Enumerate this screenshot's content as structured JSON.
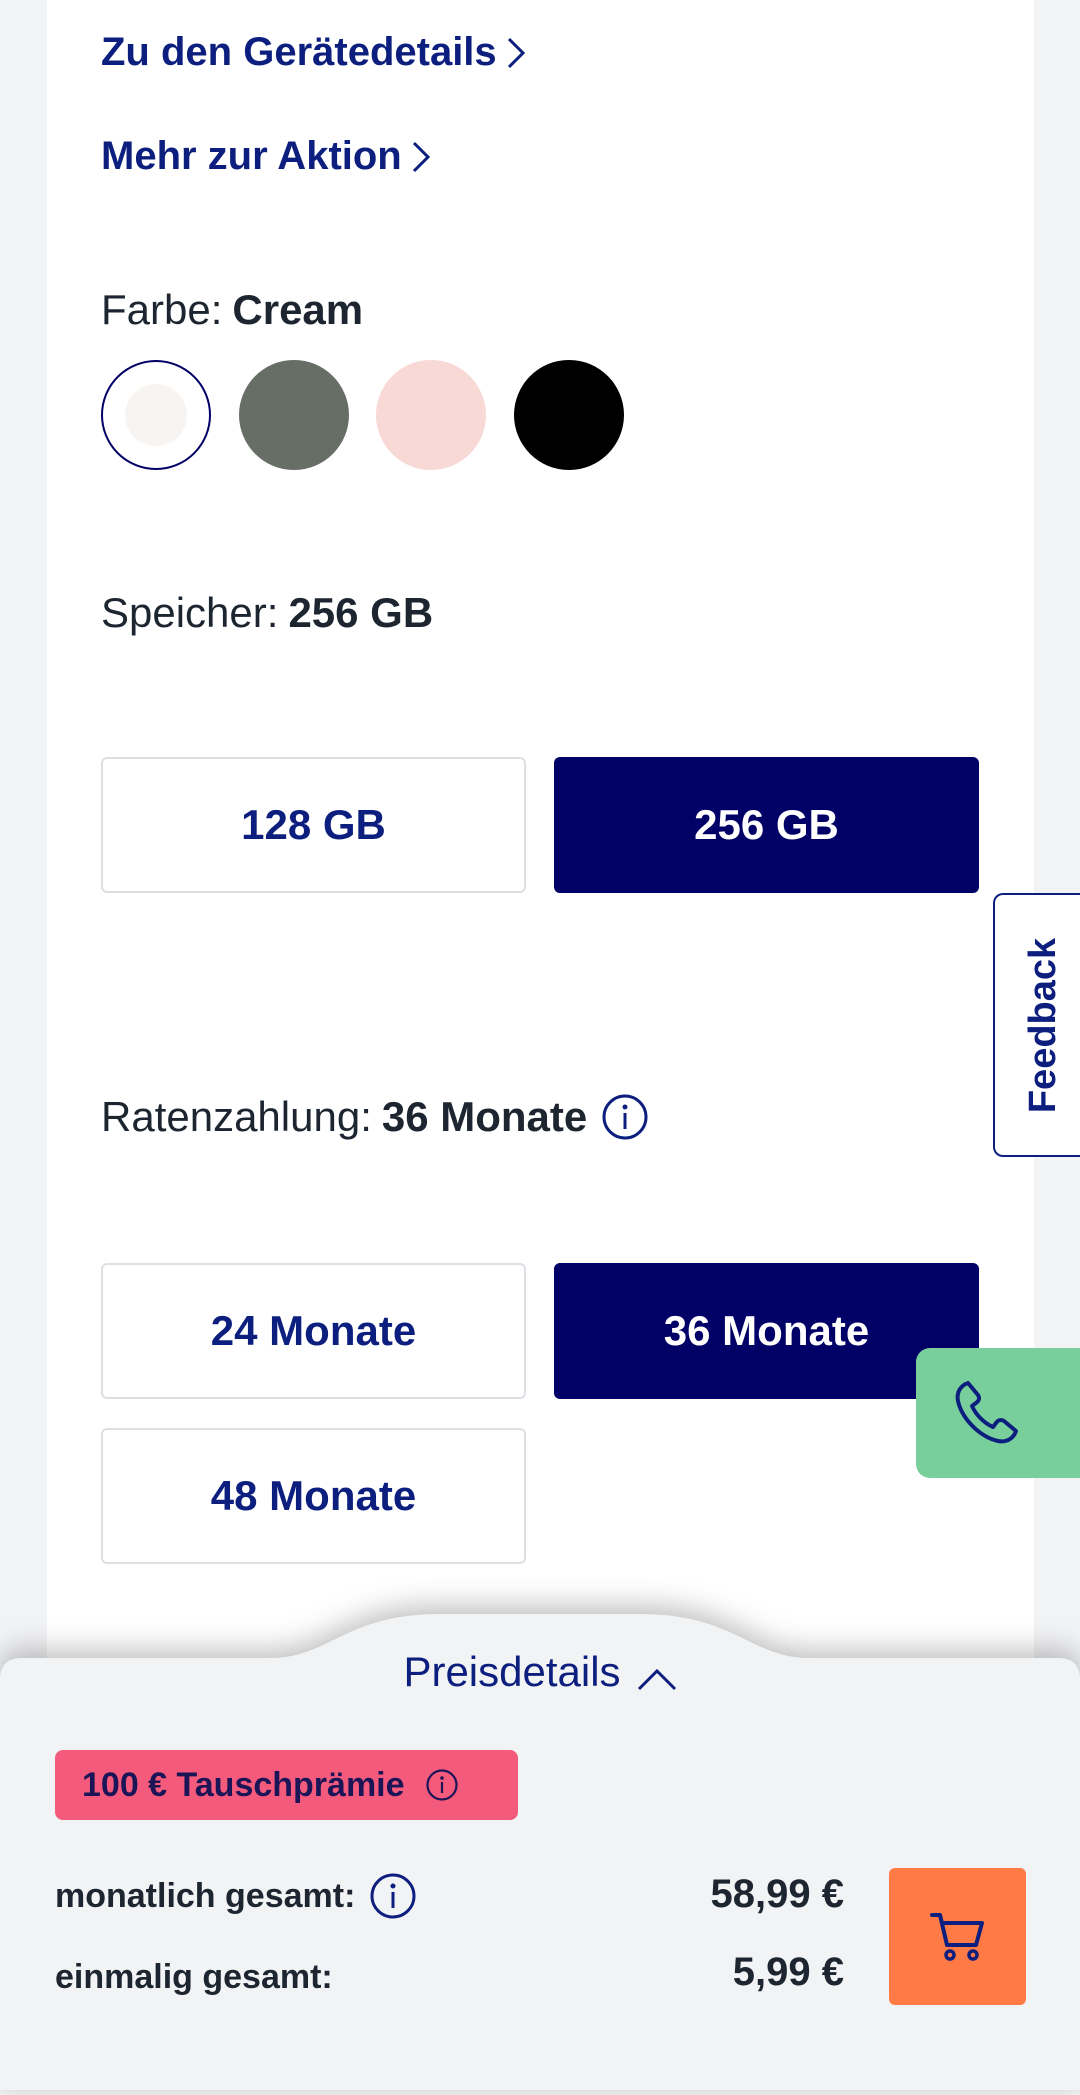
{
  "links": {
    "device_details": "Zu den Gerätedetails",
    "promo_more": "Mehr zur Aktion"
  },
  "color": {
    "label": "Farbe:",
    "selected": "Cream",
    "swatches": [
      {
        "name": "cream",
        "hex": "#f7f4f1",
        "selected": true
      },
      {
        "name": "gray-green",
        "hex": "#676e66",
        "selected": false
      },
      {
        "name": "pink",
        "hex": "#f8d9d6",
        "selected": false
      },
      {
        "name": "black",
        "hex": "#000000",
        "selected": false
      }
    ]
  },
  "storage": {
    "label": "Speicher:",
    "selected": "256 GB",
    "options": [
      "128 GB",
      "256 GB"
    ]
  },
  "installments": {
    "label": "Ratenzahlung:",
    "selected": "36 Monate",
    "info_icon": "info-icon",
    "options": [
      "24 Monate",
      "36 Monate",
      "48 Monate"
    ]
  },
  "feedback_tab": "Feedback",
  "call_button_icon": "phone-icon",
  "price_panel": {
    "toggle_label": "Preisdetails",
    "toggle_icon": "chevron-up-icon",
    "badge": "100 € Tauschprämie",
    "monthly_label": "monatlich gesamt:",
    "monthly_value": "58,99 €",
    "once_label": "einmalig gesamt:",
    "once_value": "5,99 €",
    "cart_icon": "cart-icon"
  },
  "colors": {
    "primary_navy": "#010066",
    "link_blue": "#0d1f7e",
    "badge_pink": "#f45a7c",
    "cart_orange": "#ff7a44",
    "call_green": "#79cf9c"
  }
}
